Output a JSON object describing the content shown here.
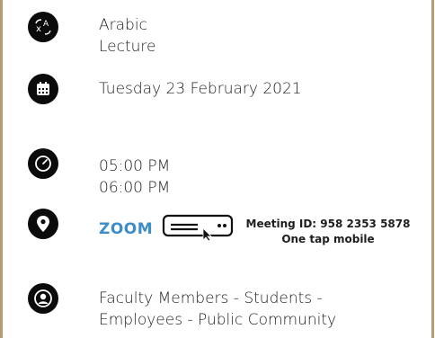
{
  "topic": {
    "line1": "Arabic",
    "line2": "Lecture"
  },
  "date": {
    "text": "Tuesday 23 February 2021"
  },
  "time": {
    "start": "05:00 PM",
    "end": "06:00 PM"
  },
  "location": {
    "platform": "ZOOM",
    "meeting_id": "Meeting ID: 958 2353 5878",
    "one_tap": "One tap mobile"
  },
  "audience": {
    "line1": "Faculty Members - Students -",
    "line2": "Employees - Public Community"
  },
  "colors": {
    "frame": "#b69a72",
    "zoom": "#3d8dc9",
    "icon_bg": "#0b0b0b"
  }
}
